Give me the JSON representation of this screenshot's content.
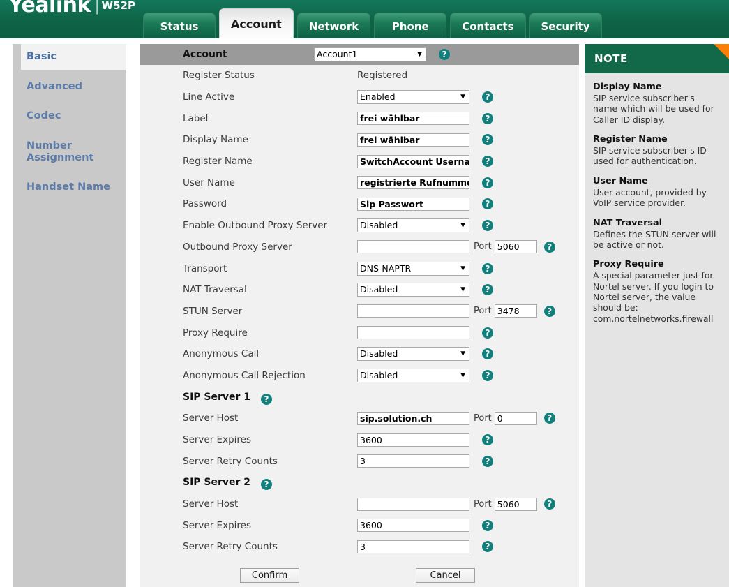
{
  "header": {
    "brand": "Yealink",
    "divider": "|",
    "model": "W52P",
    "tabs": [
      {
        "label": "Status",
        "active": false
      },
      {
        "label": "Account",
        "active": true
      },
      {
        "label": "Network",
        "active": false
      },
      {
        "label": "Phone",
        "active": false
      },
      {
        "label": "Contacts",
        "active": false
      },
      {
        "label": "Security",
        "active": false
      }
    ]
  },
  "sidebar": {
    "items": [
      {
        "label": "Basic",
        "active": true
      },
      {
        "label": "Advanced",
        "active": false
      },
      {
        "label": "Codec",
        "active": false
      },
      {
        "label": "Number Assignment",
        "active": false
      },
      {
        "label": "Handset Name",
        "active": false
      }
    ]
  },
  "form": {
    "section_title": "Account",
    "account_select": "Account1",
    "rows": [
      {
        "label": "Register Status",
        "type": "static",
        "value": "Registered"
      },
      {
        "label": "Line Active",
        "type": "select",
        "value": "Enabled"
      },
      {
        "label": "Label",
        "type": "text",
        "value": "frei wählbar",
        "strong": true
      },
      {
        "label": "Display Name",
        "type": "text",
        "value": "frei wählbar",
        "strong": true
      },
      {
        "label": "Register Name",
        "type": "text",
        "value": "SwitchAccount Username",
        "strong": true
      },
      {
        "label": "User Name",
        "type": "text",
        "value": "registrierte Rufnummer",
        "strong": true
      },
      {
        "label": "Password",
        "type": "text",
        "value": "Sip Passwort",
        "strong": true
      },
      {
        "label": "Enable Outbound Proxy Server",
        "type": "select",
        "value": "Disabled"
      },
      {
        "label": "Outbound Proxy Server",
        "type": "text-port",
        "value": "",
        "port_label": "Port",
        "port": "5060"
      },
      {
        "label": "Transport",
        "type": "select",
        "value": "DNS-NAPTR"
      },
      {
        "label": "NAT Traversal",
        "type": "select",
        "value": "Disabled"
      },
      {
        "label": "STUN Server",
        "type": "text-port",
        "value": "",
        "port_label": "Port",
        "port": "3478"
      },
      {
        "label": "Proxy Require",
        "type": "text",
        "value": ""
      },
      {
        "label": "Anonymous Call",
        "type": "select",
        "value": "Disabled"
      },
      {
        "label": "Anonymous Call Rejection",
        "type": "select",
        "value": "Disabled"
      },
      {
        "label": "SIP Server 1",
        "type": "heading"
      },
      {
        "label": "Server Host",
        "type": "text-port",
        "value": "sip.solution.ch",
        "strong": true,
        "port_label": "Port",
        "port": "0"
      },
      {
        "label": "Server Expires",
        "type": "text",
        "value": "3600"
      },
      {
        "label": "Server Retry Counts",
        "type": "text",
        "value": "3"
      },
      {
        "label": "SIP Server 2",
        "type": "heading"
      },
      {
        "label": "Server Host",
        "type": "text-port",
        "value": "",
        "port_label": "Port",
        "port": "5060"
      },
      {
        "label": "Server Expires",
        "type": "text",
        "value": "3600"
      },
      {
        "label": "Server Retry Counts",
        "type": "text",
        "value": "3"
      }
    ],
    "confirm_label": "Confirm",
    "cancel_label": "Cancel",
    "help_glyph": "?"
  },
  "note": {
    "title": "NOTE",
    "items": [
      {
        "title": "Display Name",
        "text": "SIP service subscriber's name which will be used for Caller ID display."
      },
      {
        "title": "Register Name",
        "text": "SIP service subscriber's ID used for authentication."
      },
      {
        "title": "User Name",
        "text": "User account, provided by VoIP service provider."
      },
      {
        "title": "NAT Traversal",
        "text": "Defines the STUN server will be active or not."
      },
      {
        "title": "Proxy Require",
        "text": "A special parameter just for Nortel server. If you login to Nortel server, the value should be: com.nortelnetworks.firewall"
      }
    ]
  },
  "colors": {
    "brand_green": "#12694a",
    "accent_orange": "#fb7e05",
    "help_teal": "#11807c",
    "sidebar_gray": "#c9c9c9",
    "section_header_gray": "#9a9a9a"
  }
}
